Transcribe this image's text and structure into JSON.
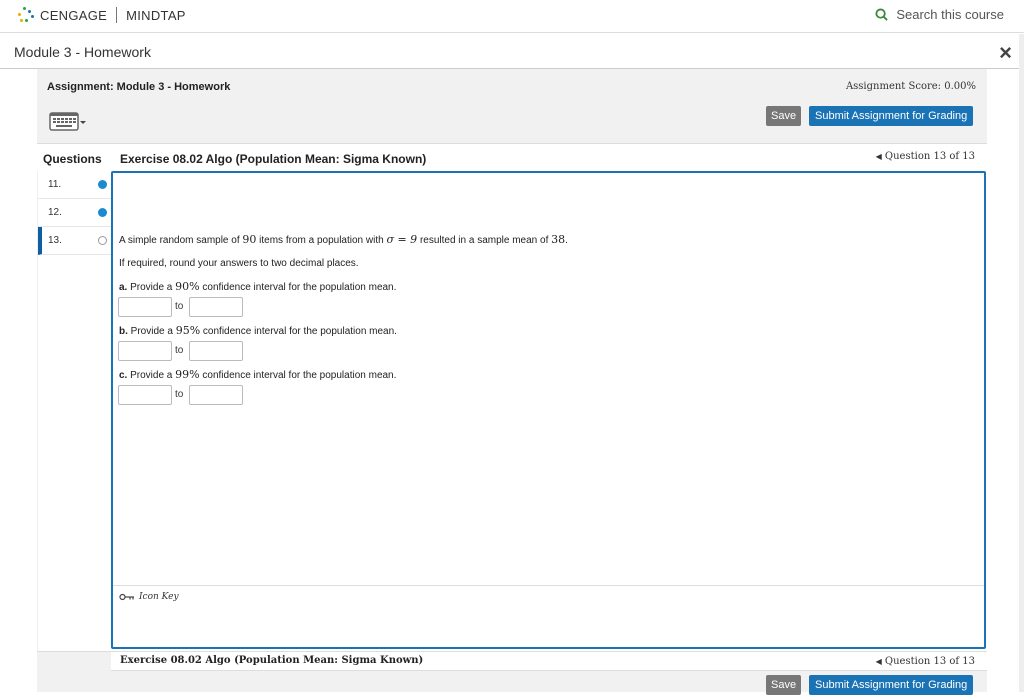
{
  "topbar": {
    "brand": "CENGAGE",
    "product": "MINDTAP",
    "search_label": "Search this course"
  },
  "module": {
    "title": "Module 3 - Homework",
    "close_label": "×"
  },
  "assignment": {
    "title": "Assignment: Module 3 - Homework",
    "score": "Assignment Score: 0.00%",
    "save_label": "Save",
    "submit_label": "Submit Assignment for Grading"
  },
  "questions_header": {
    "label": "Questions",
    "exercise_title": "Exercise 08.02 Algo (Population Mean: Sigma Known)",
    "position": "Question 13 of 13"
  },
  "question_list": [
    {
      "number": "11.",
      "status": "answered"
    },
    {
      "number": "12.",
      "status": "answered"
    },
    {
      "number": "13.",
      "status": "unanswered"
    }
  ],
  "question": {
    "intro_pre": "A simple random sample of ",
    "n": "90",
    "intro_mid": " items from a population with ",
    "sigma": "σ = 9",
    "intro_post": " resulted in a sample mean of ",
    "mean": "38",
    "intro_end": ".",
    "round_note": "If required, round your answers to two decimal places.",
    "parts": [
      {
        "letter": "a.",
        "pre": "Provide a ",
        "level": "90%",
        "post": " confidence interval for the population mean.",
        "to": "to",
        "lower": "",
        "upper": ""
      },
      {
        "letter": "b.",
        "pre": "Provide a ",
        "level": "95%",
        "post": " confidence interval for the population mean.",
        "to": "to",
        "lower": "",
        "upper": ""
      },
      {
        "letter": "c.",
        "pre": "Provide a ",
        "level": "99%",
        "post": " confidence interval for the population mean.",
        "to": "to",
        "lower": "",
        "upper": ""
      }
    ],
    "icon_key": "Icon Key"
  },
  "footer": {
    "exercise_title": "Exercise 08.02 Algo (Population Mean: Sigma Known)",
    "position": "Question 13 of 13",
    "save_label": "Save",
    "submit_label": "Submit Assignment for Grading"
  },
  "colors": {
    "accent": "#1a73b5",
    "answered_dot": "#1a8ad1",
    "save_button": "#777777",
    "search_icon": "#3a8a3a"
  }
}
